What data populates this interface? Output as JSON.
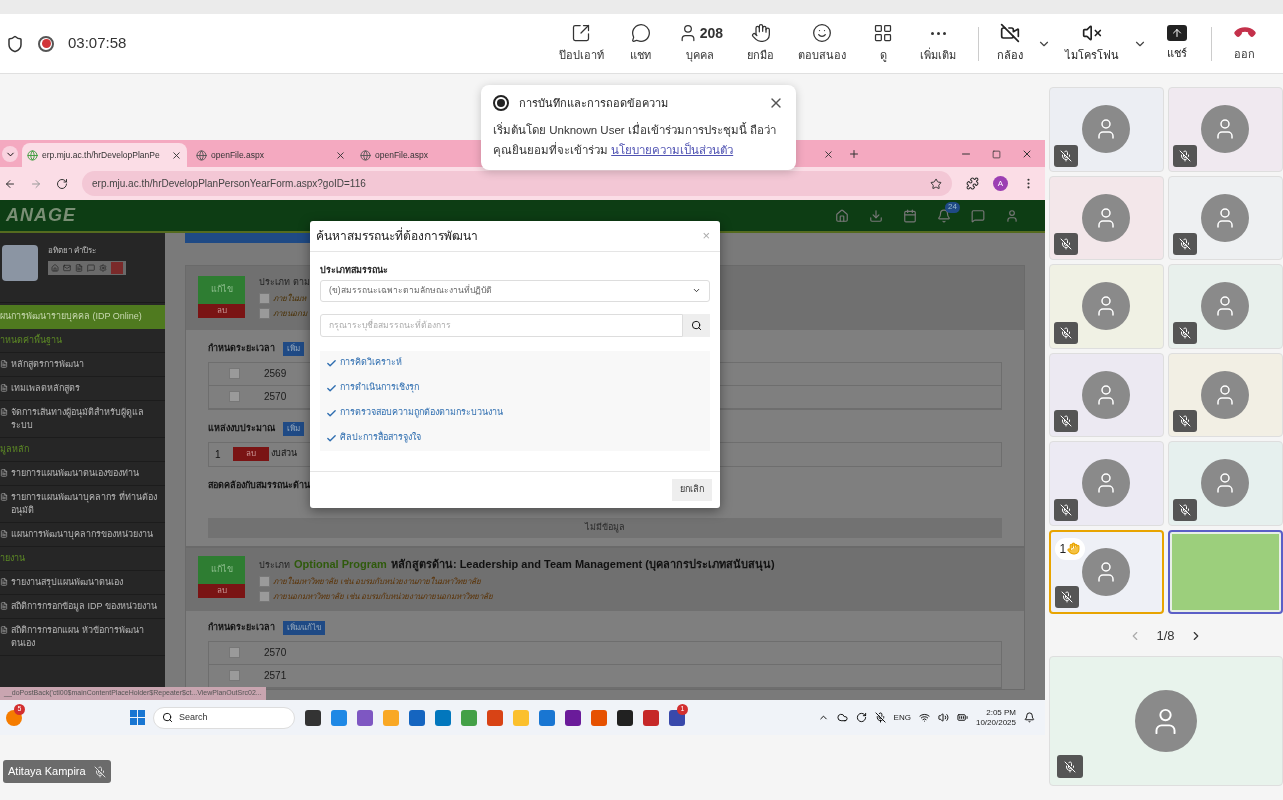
{
  "call_bar": {
    "timer": "03:07:58",
    "recording": true,
    "actions": [
      {
        "label": "ป๊อปเอาท์"
      },
      {
        "label": "แชท"
      },
      {
        "label": "บุคคล",
        "count": "208"
      },
      {
        "label": "ยกมือ"
      },
      {
        "label": "ตอบสนอง"
      },
      {
        "label": "ดู"
      },
      {
        "label": "เพิ่มเติม"
      }
    ],
    "camera": {
      "label": "กล้อง",
      "on": false
    },
    "microphone": {
      "label": "ไมโครโฟน",
      "on": false
    },
    "share": {
      "label": "แชร์"
    },
    "leave": {
      "label": "ออก"
    }
  },
  "toast": {
    "title": "การบันทึกและการถอดข้อความ",
    "message": "เริ่มต้นโดย Unknown User เมื่อเข้าร่วมการประชุมนี้ ถือว่าคุณยินยอมที่จะเข้าร่วม",
    "link": "นโยบายความเป็นส่วนตัว"
  },
  "browser": {
    "tabs": [
      {
        "label": "erp.mju.ac.th/hrDevelopPlanPe",
        "selected": true
      },
      {
        "label": "openFile.aspx",
        "selected": false
      },
      {
        "label": "openFile.aspx",
        "selected": false
      }
    ],
    "url": "erp.mju.ac.th/hrDevelopPlanPersonYearForm.aspx?goID=116",
    "profile": "A",
    "status_url": "__doPostBack('ctl00$mainContentPlaceHolder$Repeater$ct...ViewPlanOutSrc02..."
  },
  "app": {
    "logo": "ANAGE",
    "notification_count": "24",
    "user_name": "อทิตยา คำปีระ",
    "menu": [
      {
        "kind": "header",
        "label": "ผนการพัฒนารายบุคคล (IDP Online)"
      },
      {
        "kind": "section",
        "label": "าหนดค่าพื้นฐาน"
      },
      {
        "kind": "item",
        "label": "หลักสูตรการพัฒนา"
      },
      {
        "kind": "item",
        "label": "เทมเพลตหลักสูตร"
      },
      {
        "kind": "item",
        "label": "จัดการเส้นทางผู้อนุมัติสำหรับผู้ดูแลระบบ"
      },
      {
        "kind": "section",
        "label": "มูลหลัก"
      },
      {
        "kind": "item",
        "label": "รายการแผนพัฒนาตนเองของท่าน"
      },
      {
        "kind": "item",
        "label": "รายการแผนพัฒนาบุคลากร ที่ท่านต้องอนุมัติ"
      },
      {
        "kind": "item",
        "label": "แผนการพัฒนาบุคลากรของหน่วยงาน"
      },
      {
        "kind": "section",
        "label": "ายงาน"
      },
      {
        "kind": "item",
        "label": "รายงานสรุปแผนพัฒนาตนเอง"
      },
      {
        "kind": "item",
        "label": "สถิติการกรอกข้อมูล IDP ของหน่วยงาน"
      },
      {
        "kind": "item",
        "label": "สถิติการกรอกแผน หัวข้อการพัฒนาตนเอง"
      }
    ],
    "plan_1": {
      "edit": "แก้ไข",
      "delete": "ลบ",
      "type_label": "ประเภท ตาม",
      "options": [
        {
          "label": "ภายในมห",
          "checked": false
        },
        {
          "label": "ภายนอกม",
          "checked": false
        }
      ],
      "period_label": "กำหนดระยะเวลา",
      "period_button": "เพิ่ม",
      "years": [
        {
          "year": "2569",
          "checked": false
        },
        {
          "year": "2570",
          "checked": false
        }
      ],
      "budget_label": "แหล่งงบประมาณ",
      "budget_button": "เพิ่ม",
      "budget_rows": [
        {
          "index": "1",
          "delete": "ลบ",
          "source": "งบส่วน"
        }
      ],
      "competency_label": "สอดคล้องกับสมรรถนะด้าน",
      "empty": "ไม่มีข้อมูล"
    },
    "plan_2": {
      "edit": "แก้ไข",
      "delete": "ลบ",
      "type_label": "ประเภท",
      "type_value": "Optional Program",
      "course": "หลักสูตรด้าน: Leadership and Team Management (บุคลากรประเภทสนับสนุน)",
      "options": [
        {
          "label": "ภายในมหาวิทยาลัย เช่น อบรมกับหน่วยงานภายในมหาวิทยาลัย",
          "checked": false
        },
        {
          "label": "ภายนอกมหาวิทยาลัย เช่น อบรมกับหน่วยงานภายนอกมหาวิทยาลัย",
          "checked": false
        }
      ],
      "period_label": "กำหนดระยะเวลา",
      "period_button": "เพิ่ม/แก้ไข",
      "years": [
        {
          "year": "2570",
          "checked": false
        },
        {
          "year": "2571",
          "checked": false
        }
      ]
    }
  },
  "dialog": {
    "title": "ค้นหาสมรรถนะที่ต้องการพัฒนา",
    "close": "×",
    "type_label": "ประเภทสมรรถนะ",
    "type_value": "(ข)สมรรถนะเฉพาะตามลักษณะงานที่ปฏิบัติ",
    "search_placeholder": "กรุณาระบุชื่อสมรรถนะที่ต้องการ",
    "items": [
      {
        "label": "การคิดวิเคราะห์",
        "checked": true
      },
      {
        "label": "การดำเนินการเชิงรุก",
        "checked": true
      },
      {
        "label": "การตรวจสอบความถูกต้องตามกระบวนงาน",
        "checked": true
      },
      {
        "label": "ศิลปะการสื่อสารจูงใจ",
        "checked": true
      }
    ],
    "cancel": "ยกเลิก"
  },
  "taskbar": {
    "notification_badge": "5",
    "search": "Search",
    "app_badge": "1",
    "language": "ENG",
    "time": "2:05 PM",
    "date": "10/20/2025"
  },
  "presenter": {
    "name": "Atitaya Kampira",
    "muted": true
  },
  "gallery": {
    "tiles": [
      {
        "kind": "avatar",
        "muted": true
      },
      {
        "kind": "avatar",
        "muted": true
      },
      {
        "kind": "avatar",
        "muted": true
      },
      {
        "kind": "avatar",
        "muted": true
      },
      {
        "kind": "avatar",
        "muted": true
      },
      {
        "kind": "avatar",
        "muted": true
      },
      {
        "kind": "avatar",
        "muted": true
      },
      {
        "kind": "avatar",
        "muted": true
      },
      {
        "kind": "avatar",
        "muted": true
      },
      {
        "kind": "avatar",
        "muted": true
      },
      {
        "kind": "avatar",
        "muted": true,
        "hand_count": "1"
      },
      {
        "kind": "video",
        "muted": false
      }
    ],
    "page": "1/8",
    "self_tile": {
      "muted": true
    }
  }
}
